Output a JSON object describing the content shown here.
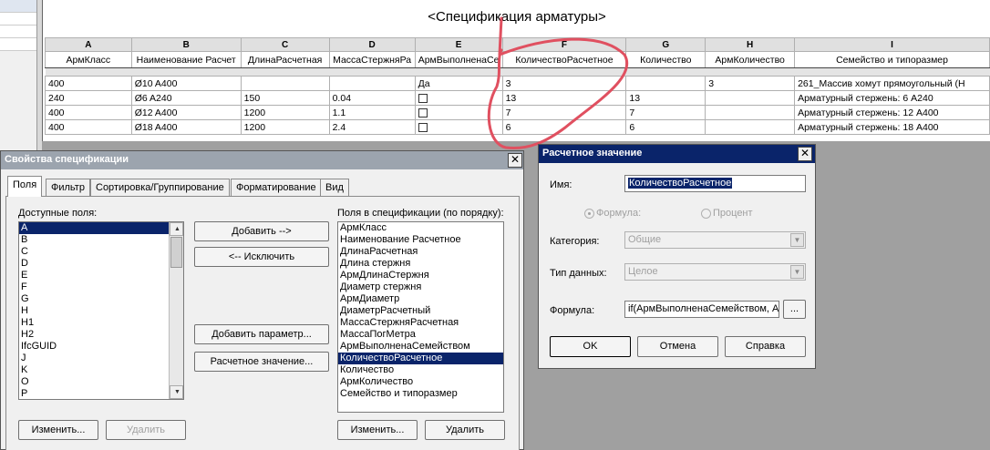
{
  "schedule": {
    "title": "<Спецификация арматуры>",
    "column_letters": [
      "A",
      "B",
      "C",
      "D",
      "E",
      "F",
      "G",
      "H",
      "I"
    ],
    "headers": [
      "АрмКласс",
      "Наименование Расчет",
      "ДлинаРасчетная",
      "МассаСтержняРа",
      "АрмВыполненаСе",
      "КоличествоРасчетное",
      "Количество",
      "АрмКоличество",
      "Семейство и типоразмер"
    ],
    "rows": [
      {
        "a": "400",
        "b": "Ø10 A400",
        "c": "",
        "d": "",
        "e": "Да",
        "f": "3",
        "g": "",
        "h": "3",
        "i": "261_Массив хомут прямоугольный (Н"
      },
      {
        "a": "240",
        "b": "Ø6 A240",
        "c": "150",
        "d": "0.04",
        "e": "",
        "f": "13",
        "g": "13",
        "h": "",
        "i": "Арматурный стержень: 6 A240"
      },
      {
        "a": "400",
        "b": "Ø12 A400",
        "c": "1200",
        "d": "1.1",
        "e": "",
        "f": "7",
        "g": "7",
        "h": "",
        "i": "Арматурный стержень: 12 A400"
      },
      {
        "a": "400",
        "b": "Ø18 A400",
        "c": "1200",
        "d": "2.4",
        "e": "",
        "f": "6",
        "g": "6",
        "h": "",
        "i": "Арматурный стержень: 18 A400"
      }
    ],
    "annotation_color": "#e05060"
  },
  "props_dialog": {
    "title": "Свойства спецификации",
    "close": "✕",
    "tabs": [
      "Поля",
      "Фильтр",
      "Сортировка/Группирование",
      "Форматирование",
      "Вид"
    ],
    "available_label": "Доступные поля:",
    "available_fields": [
      "A",
      "B",
      "C",
      "D",
      "E",
      "F",
      "G",
      "H",
      "H1",
      "H2",
      "IfcGUID",
      "J",
      "K",
      "O",
      "P"
    ],
    "available_selected": "A",
    "in_schedule_label": "Поля в спецификации (по порядку):",
    "schedule_fields": [
      "АрмКласс",
      "Наименование Расчетное",
      "ДлинаРасчетная",
      "Длина стержня",
      "АрмДлинаСтержня",
      "Диаметр стержня",
      "АрмДиаметр",
      "ДиаметрРасчетный",
      "МассаСтержняРасчетная",
      "МассаПогМетра",
      "АрмВыполненаСемейством",
      "КоличествоРасчетное",
      "Количество",
      "АрмКоличество",
      "Семейство и типоразмер"
    ],
    "schedule_selected": "КоличествоРасчетное",
    "btn_add": "Добавить -->",
    "btn_remove": "<-- Исключить",
    "btn_add_param": "Добавить параметр...",
    "btn_calc": "Расчетное значение...",
    "btn_edit_left": "Изменить...",
    "btn_delete_left": "Удалить",
    "btn_edit_right": "Изменить...",
    "btn_delete_right": "Удалить"
  },
  "calc_dialog": {
    "title": "Расчетное значение",
    "close": "✕",
    "name_label": "Имя:",
    "name_value": "КоличествоРасчетное",
    "radio_formula": "Формула:",
    "radio_percent": "Процент",
    "category_label": "Категория:",
    "category_value": "Общие",
    "type_label": "Тип данных:",
    "type_value": "Целое",
    "formula_label": "Формула:",
    "formula_value": "if(АрмВыполненаСемейством, Ар",
    "formula_btn": "...",
    "ok": "OK",
    "cancel": "Отмена",
    "help": "Справка"
  }
}
